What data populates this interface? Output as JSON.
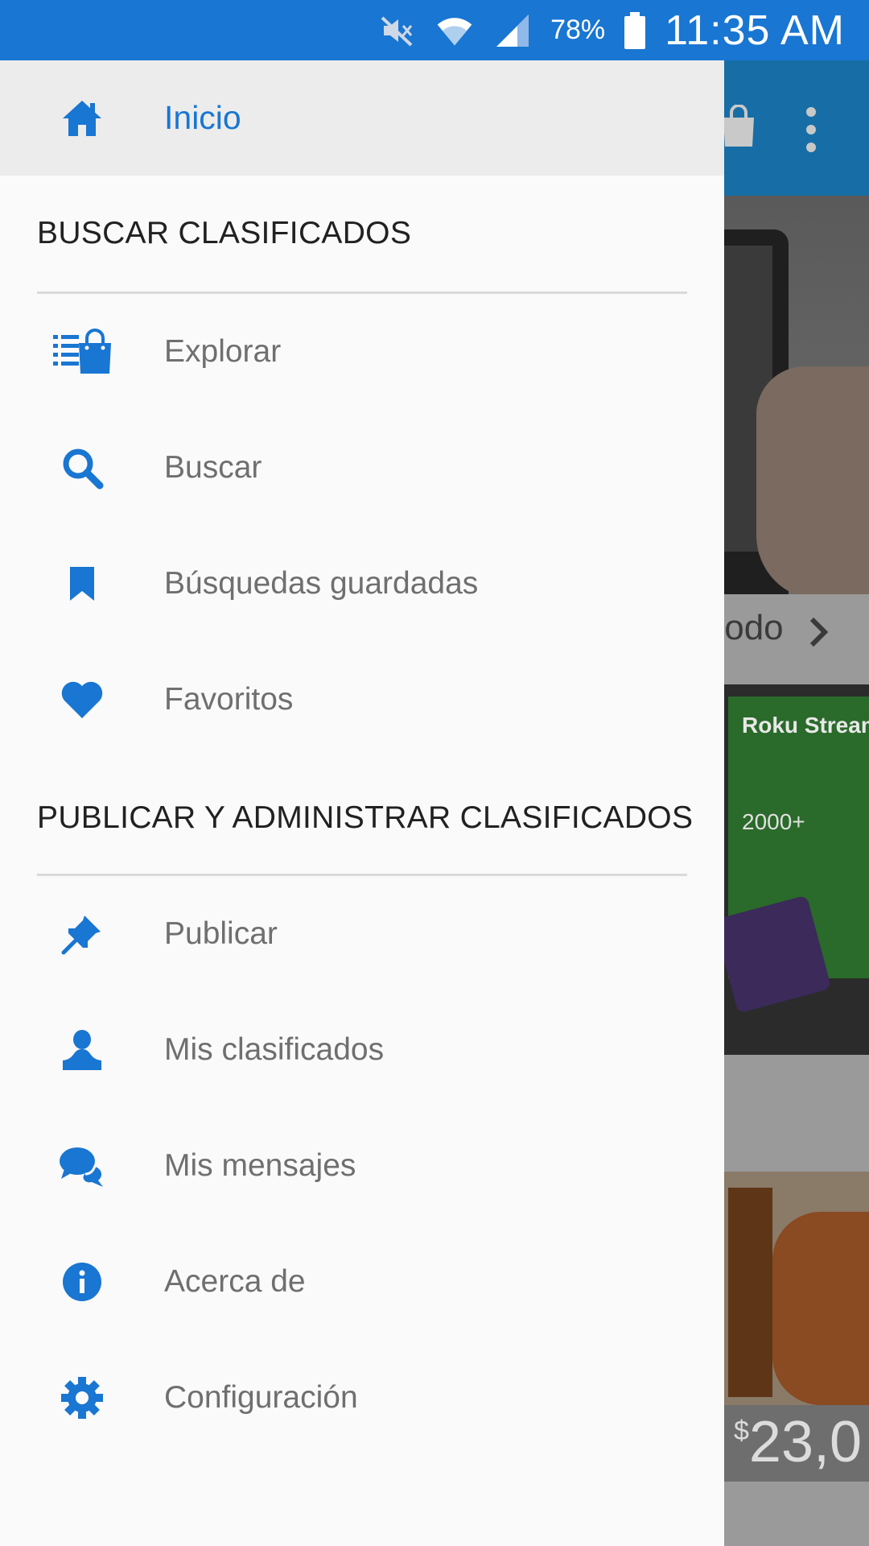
{
  "status_bar": {
    "battery": "78%",
    "time": "11:35 AM"
  },
  "drawer": {
    "home_label": "Inicio",
    "sections": [
      {
        "title": "BUSCAR CLASIFICADOS",
        "items": [
          {
            "label": "Explorar",
            "icon": "shopping-list-icon"
          },
          {
            "label": "Buscar",
            "icon": "search-icon"
          },
          {
            "label": "Búsquedas guardadas",
            "icon": "bookmark-icon"
          },
          {
            "label": "Favoritos",
            "icon": "heart-icon"
          }
        ]
      },
      {
        "title": "PUBLICAR Y ADMINISTRAR CLASIFICADOS",
        "items": [
          {
            "label": "Publicar",
            "icon": "pin-icon"
          },
          {
            "label": "Mis clasificados",
            "icon": "user-icon"
          },
          {
            "label": "Mis mensajes",
            "icon": "chat-icon"
          },
          {
            "label": "Acerca de",
            "icon": "info-icon"
          },
          {
            "label": "Configuración",
            "icon": "gear-icon"
          }
        ]
      }
    ]
  },
  "background": {
    "see_all_text": "todo",
    "roku_title": "Roku Stream",
    "roku_channels": "2000+",
    "price_currency": "$",
    "price_amount": "23,0"
  },
  "colors": {
    "status_bar": "#1976d2",
    "accent": "#1976d2",
    "drawer_bg": "#fafafa",
    "home_row_bg": "#ececec"
  }
}
